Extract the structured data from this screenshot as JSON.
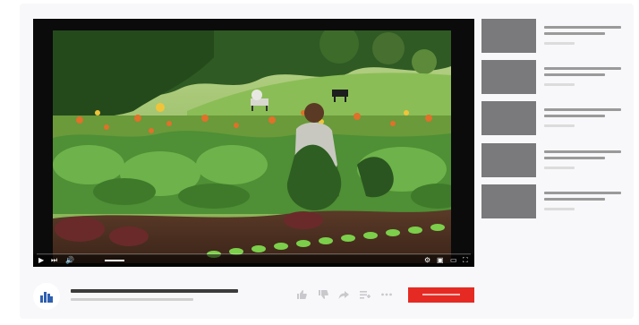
{
  "player": {
    "controls": {
      "play_icon": "play-icon",
      "next_icon": "next-icon",
      "volume_icon": "volume-icon",
      "settings_icon": "gear-icon",
      "miniplayer_icon": "miniplayer-icon",
      "theater_icon": "theater-mode-icon",
      "fullscreen_icon": "fullscreen-icon"
    },
    "progress_fraction": 0.0,
    "volume_fraction": 1.0
  },
  "sidebar": {
    "items": [
      {
        "thumb": "video-thumbnail"
      },
      {
        "thumb": "video-thumbnail"
      },
      {
        "thumb": "video-thumbnail"
      },
      {
        "thumb": "video-thumbnail"
      },
      {
        "thumb": "video-thumbnail"
      }
    ]
  },
  "info": {
    "channel_icon": "channel-logo-icon",
    "actions": [
      "like-icon",
      "dislike-icon",
      "share-icon",
      "save-icon",
      "more-icon"
    ],
    "subscribe_color": "#e52a23"
  },
  "colors": {
    "player_bg": "#0b0b0b",
    "thumbnail": "#7a7a7c",
    "accent": "#e52a23"
  }
}
